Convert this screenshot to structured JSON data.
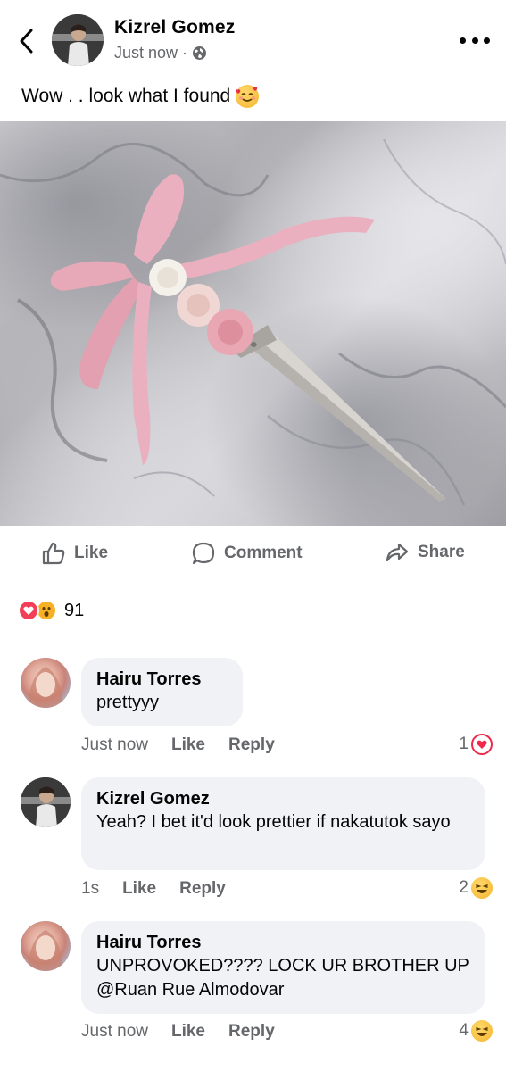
{
  "post": {
    "author": "Kizrel Gomez",
    "time": "Just now",
    "separator": "·",
    "audience_icon": "globe-icon",
    "caption": "Wow . . look what I found",
    "caption_emoji": "smiling-face-with-hearts-icon"
  },
  "actions": {
    "like": "Like",
    "comment": "Comment",
    "share": "Share"
  },
  "reactions": {
    "types": [
      "heart-icon",
      "wow-icon"
    ],
    "count": "91"
  },
  "comments": [
    {
      "author": "Hairu Torres",
      "text": "prettyyy",
      "time": "Just now",
      "like": "Like",
      "reply": "Reply",
      "reaction_count": "1",
      "reaction_icon": "heart-icon"
    },
    {
      "author": "Kizrel Gomez",
      "text": "Yeah? I bet it'd look prettier if nakatutok sayo",
      "time": "1s",
      "like": "Like",
      "reply": "Reply",
      "reaction_count": "2",
      "reaction_icon": "haha-icon"
    },
    {
      "author": "Hairu Torres",
      "text": "UNPROVOKED???? LOCK UR BROTHER UP @Ruan Rue Almodovar",
      "time": "Just now",
      "like": "Like",
      "reply": "Reply",
      "reaction_count": "4",
      "reaction_icon": "haha-icon"
    }
  ],
  "colors": {
    "text": "#050505",
    "secondary": "#65676b",
    "bubble": "#f0f2f5",
    "heart": "#f33e58",
    "wow": "#f7b125"
  }
}
